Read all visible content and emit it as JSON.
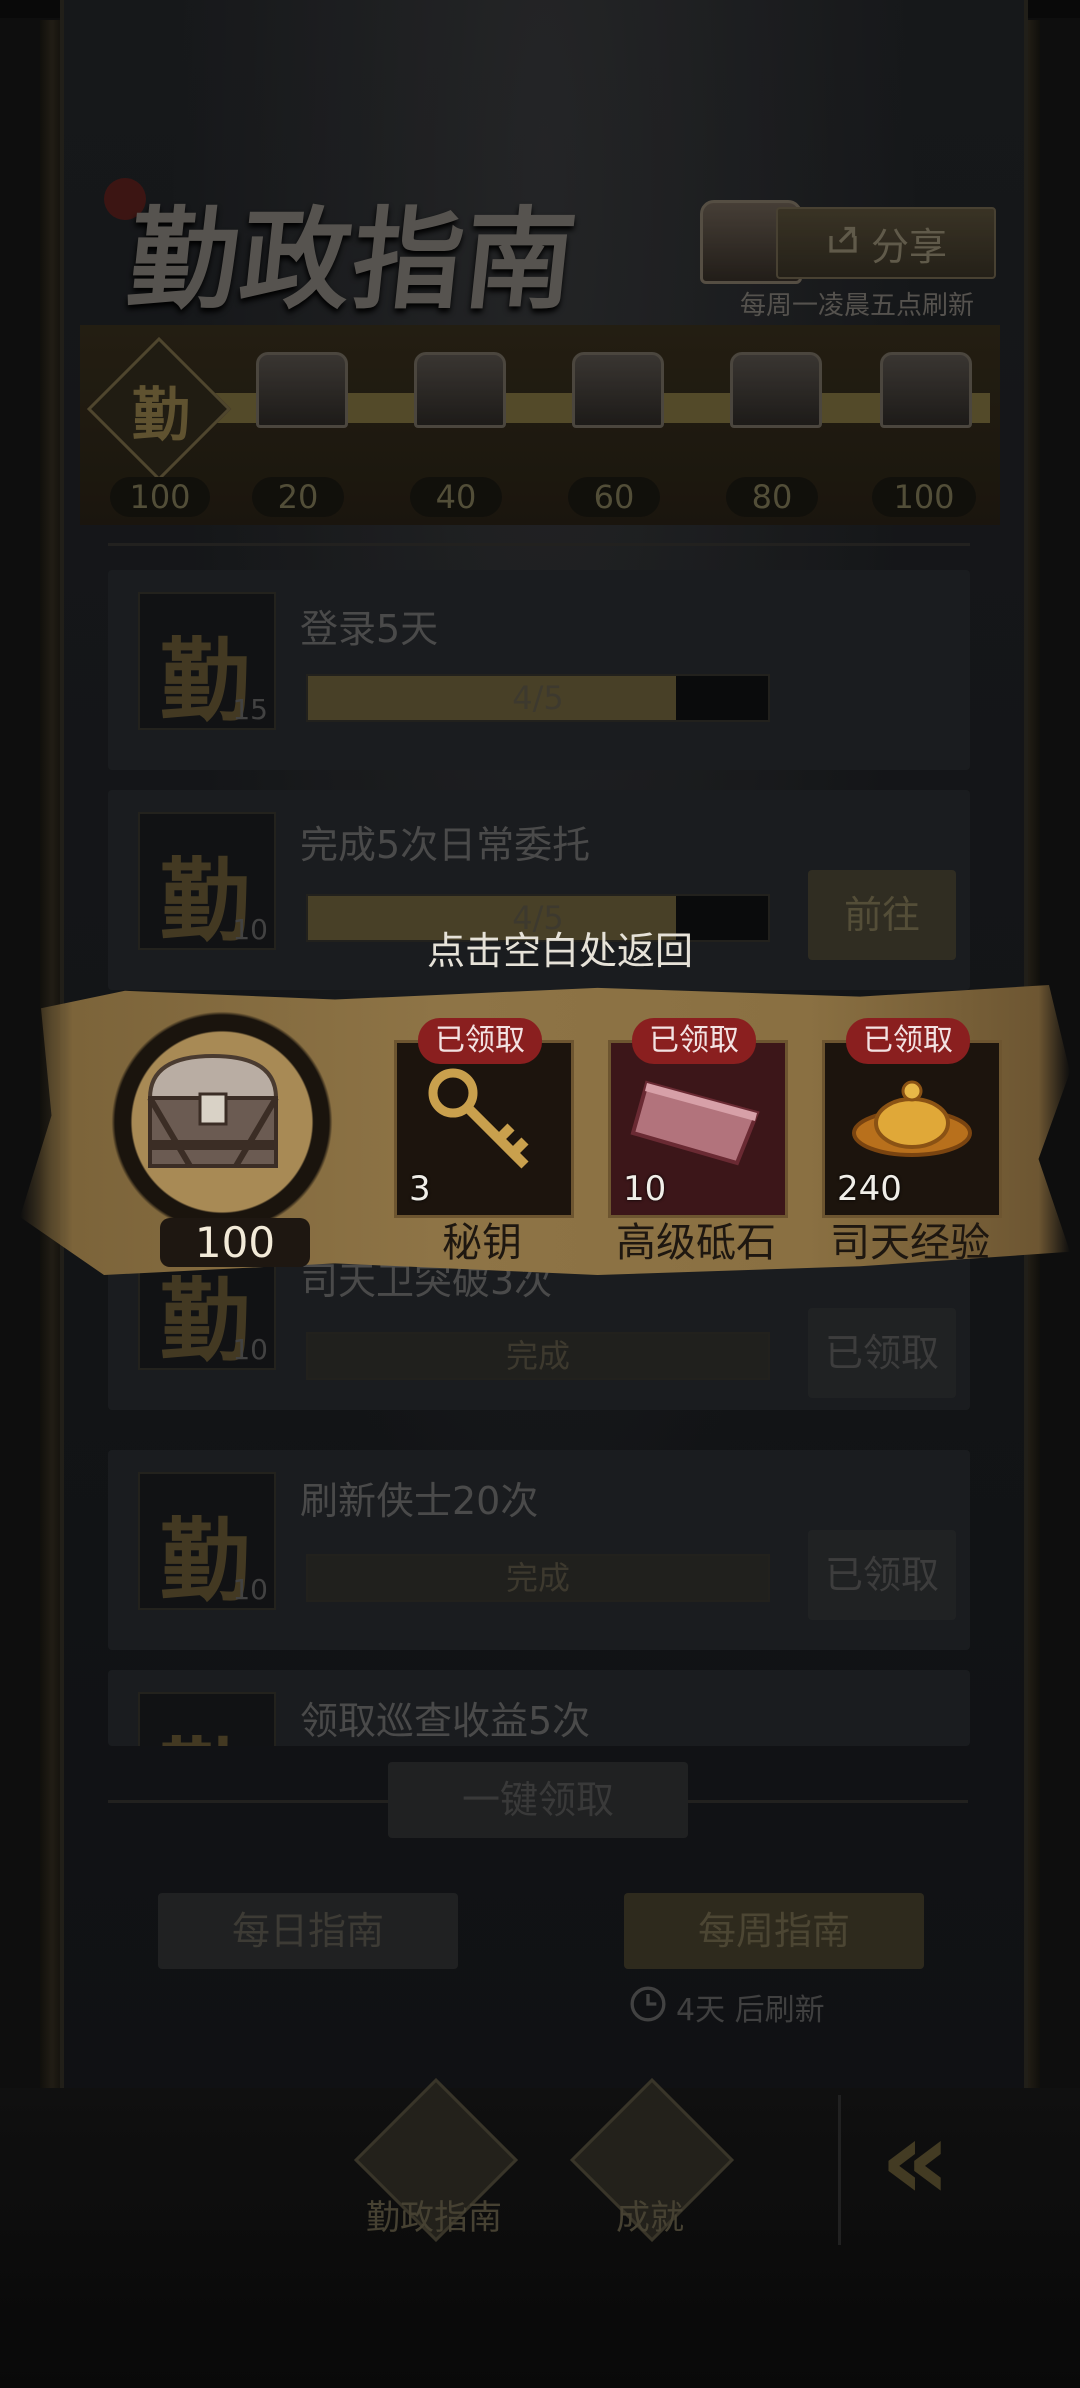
{
  "header": {
    "title": "勤政指南",
    "share_label": "分享",
    "refresh_note": "每周一凌晨五点刷新"
  },
  "progress": {
    "emblem_char": "勤",
    "current_points": "100",
    "milestones": [
      "20",
      "40",
      "60",
      "80",
      "100"
    ]
  },
  "tasks": [
    {
      "title": "登录5天",
      "icon_char": "勤",
      "points": "15",
      "progress_text": "4/5",
      "progress": 0.8,
      "button": ""
    },
    {
      "title": "完成5次日常委托",
      "icon_char": "勤",
      "points": "10",
      "progress_text": "4/5",
      "progress": 0.8,
      "button": "前往"
    },
    {
      "title": "司天卫突破3次",
      "icon_char": "勤",
      "points": "10",
      "progress_text": "完成",
      "progress": 1.0,
      "button": "已领取"
    },
    {
      "title": "刷新侠士20次",
      "icon_char": "勤",
      "points": "10",
      "progress_text": "完成",
      "progress": 1.0,
      "button": "已领取"
    },
    {
      "title": "领取巡查收益5次",
      "icon_char": "勤",
      "points": "",
      "progress_text": "",
      "progress": 0,
      "button": ""
    }
  ],
  "footer": {
    "one_key_claim": "一键领取",
    "tab_daily": "每日指南",
    "tab_weekly": "每周指南",
    "refresh_timer": "4天 后刷新"
  },
  "bottom_nav": {
    "item1": "勤政指南",
    "item2": "成就",
    "collapse_glyph": "«"
  },
  "popup": {
    "hint": "点击空白处返回",
    "chest_points": "100",
    "rewards": [
      {
        "name": "秘钥",
        "count": "3",
        "status": "已领取"
      },
      {
        "name": "高级砥石",
        "count": "10",
        "status": "已领取"
      },
      {
        "name": "司天经验",
        "count": "240",
        "status": "已领取"
      }
    ]
  },
  "colors": {
    "accent_gold": "#8e7446",
    "badge_red": "#8a1f1f"
  }
}
